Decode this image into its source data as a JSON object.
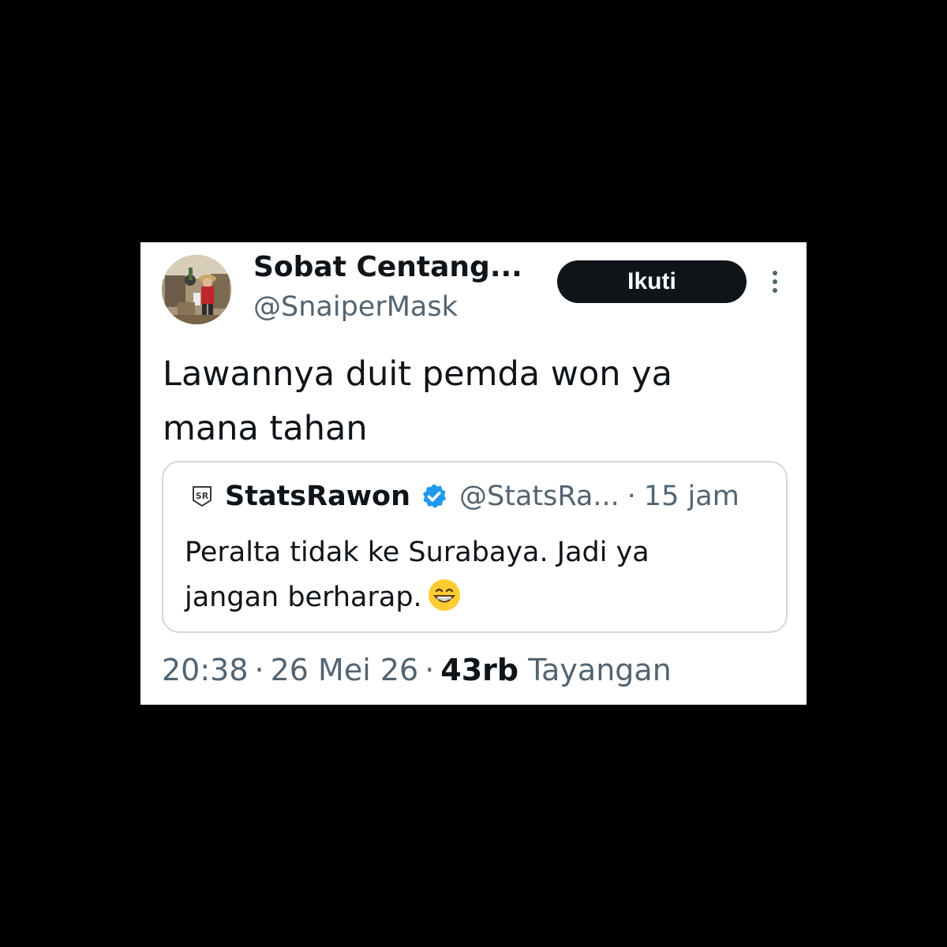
{
  "tweet": {
    "author": {
      "display_name": "Sobat Centang...",
      "handle": "@SnaiperMask"
    },
    "follow_label": "Ikuti",
    "text_lines": [
      "Lawannya duit pemda won ya",
      "mana tahan"
    ],
    "quote": {
      "author_name": "StatsRawon",
      "avatar_text": "SR",
      "handle": "@StatsRa...",
      "separator": "·",
      "time": "15 jam",
      "text_lines": [
        "Peralta tidak ke Surabaya. Jadi ya",
        "jangan berharap."
      ],
      "emoji": "grinning-face-with-smiling-eyes"
    },
    "meta": {
      "time": "20:38",
      "separator": "·",
      "date": "26 Mei 26",
      "views_count": "43rb",
      "views_label": "Tayangan"
    }
  },
  "colors": {
    "background": "#000000",
    "card": "#ffffff",
    "text_primary": "#0f1419",
    "text_secondary": "#536471",
    "border": "#cfd9de",
    "verified": "#1d9bf0"
  }
}
